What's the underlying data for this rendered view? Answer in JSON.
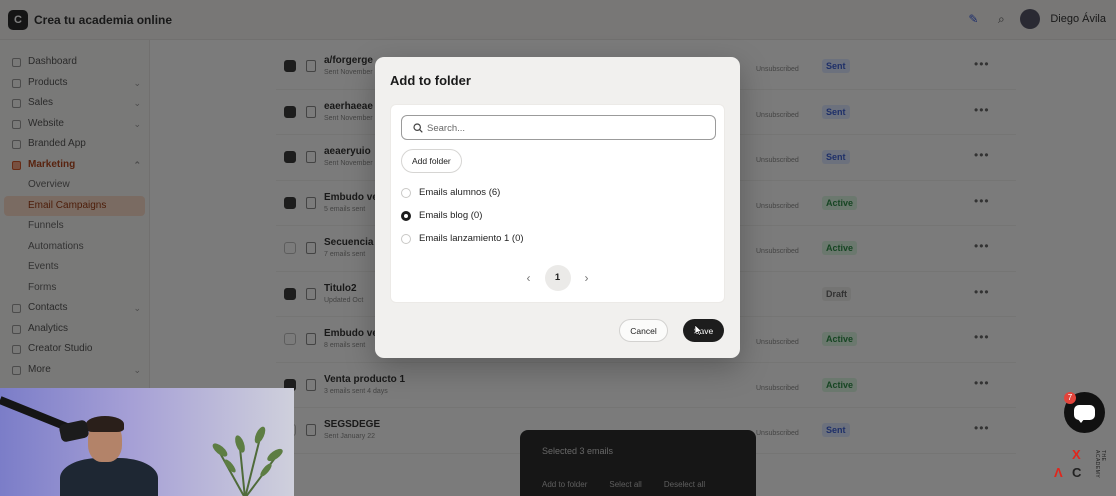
{
  "app": {
    "brand_initial": "C",
    "brand_name": "Crea tu academia online",
    "user_name": "Diego Ávila"
  },
  "sidebar": {
    "items": [
      {
        "label": "Dashboard",
        "type": "item"
      },
      {
        "label": "Products",
        "type": "item",
        "chevron": "⌄"
      },
      {
        "label": "Sales",
        "type": "item",
        "chevron": "⌄"
      },
      {
        "label": "Website",
        "type": "item",
        "chevron": "⌄"
      },
      {
        "label": "Branded App",
        "type": "item"
      },
      {
        "label": "Marketing",
        "type": "section",
        "chevron": "⌃"
      },
      {
        "label": "Overview",
        "type": "sub"
      },
      {
        "label": "Email Campaigns",
        "type": "active"
      },
      {
        "label": "Funnels",
        "type": "sub"
      },
      {
        "label": "Automations",
        "type": "sub"
      },
      {
        "label": "Events",
        "type": "sub"
      },
      {
        "label": "Forms",
        "type": "sub"
      },
      {
        "label": "Contacts",
        "type": "item",
        "chevron": "⌄"
      },
      {
        "label": "Analytics",
        "type": "item"
      },
      {
        "label": "Creator Studio",
        "type": "item"
      },
      {
        "label": "More",
        "type": "item",
        "chevron": "⌄"
      }
    ]
  },
  "table": {
    "rows": [
      {
        "name": "a/forgerge",
        "sub": "Sent November",
        "meta": "Unsubscribed",
        "status": "Sent",
        "kind": "sent"
      },
      {
        "name": "eaerhaeae",
        "sub": "Sent November",
        "meta": "Unsubscribed",
        "status": "Sent",
        "kind": "sent"
      },
      {
        "name": "aeaeryuio",
        "sub": "Sent November",
        "meta": "Unsubscribed",
        "status": "Sent",
        "kind": "sent"
      },
      {
        "name": "Embudo ven",
        "sub": "5 emails sent",
        "meta": "Unsubscribed",
        "status": "Active",
        "kind": "active"
      },
      {
        "name": "Secuencia g",
        "sub": "7 emails sent",
        "meta": "Unsubscribed",
        "status": "Active",
        "kind": "active"
      },
      {
        "name": "Titulo2",
        "sub": "Updated Oct",
        "meta": "",
        "status": "Draft",
        "kind": "draft"
      },
      {
        "name": "Embudo ven",
        "sub": "8 emails sent",
        "meta": "Unsubscribed",
        "status": "Active",
        "kind": "active"
      },
      {
        "name": "Venta producto 1",
        "sub": "3 emails sent 4 days",
        "meta": "Unsubscribed",
        "status": "Active",
        "kind": "active"
      },
      {
        "name": "SEGSDEGE",
        "sub": "Sent January 22",
        "meta": "Unsubscribed",
        "status": "Sent",
        "kind": "sent"
      }
    ]
  },
  "bulk_bar": {
    "selected": "Selected 3 emails",
    "add_to_folder": "Add to folder",
    "select_all": "Select all",
    "deselect_all": "Deselect all"
  },
  "modal": {
    "title": "Add to folder",
    "search_placeholder": "Search...",
    "add_folder_label": "Add folder",
    "folders": [
      {
        "label": "Emails alumnos (6)",
        "checked": false
      },
      {
        "label": "Emails blog (0)",
        "checked": true
      },
      {
        "label": "Emails lanzamiento 1 (0)",
        "checked": false
      }
    ],
    "pager": {
      "prev": "‹",
      "page": "1",
      "next": "›"
    },
    "cancel_label": "Cancel",
    "save_label": "Save"
  },
  "chat": {
    "badge_count": "7"
  },
  "academy_logo": {
    "glyphs": [
      "X",
      "Λ",
      "C"
    ],
    "vertical_text": "THE ACADEMY"
  },
  "colors": {
    "accent": "#1d1d1d",
    "brand": "#e1261c",
    "sent": "#3d5fd0",
    "active": "#2e8a47"
  }
}
